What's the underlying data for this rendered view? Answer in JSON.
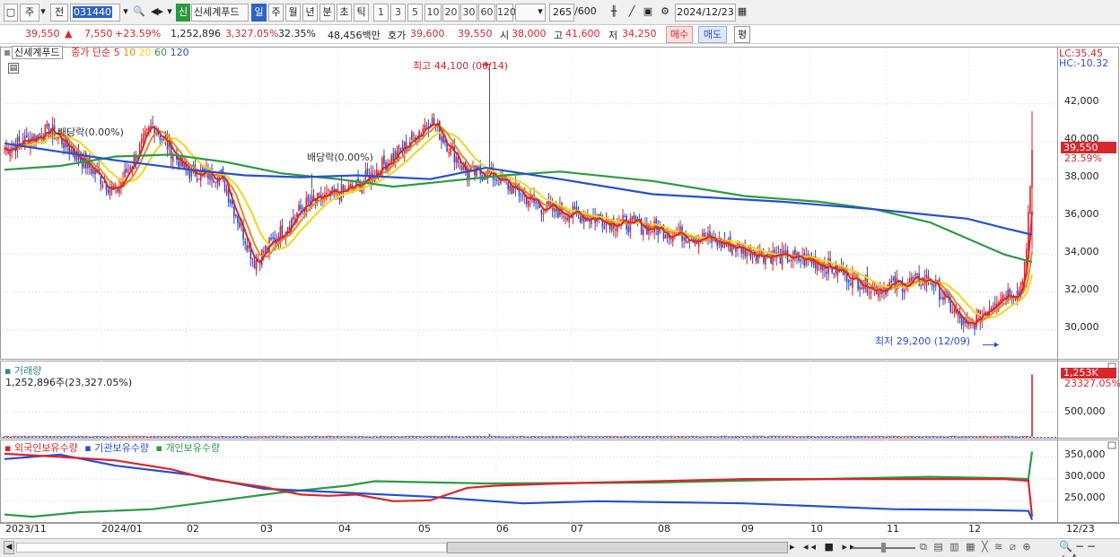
{
  "toolbar": {
    "type": "주",
    "prev": "전",
    "code": "031440",
    "stock_name": "신세계푸드",
    "badge": "신",
    "periods": [
      "일",
      "주",
      "월",
      "년",
      "분",
      "초",
      "틱"
    ],
    "active_period": "일",
    "intervals": [
      "1",
      "3",
      "5",
      "10",
      "20",
      "30",
      "60",
      "120"
    ],
    "count": "265",
    "count_total": "/600",
    "date": "2024/12/23"
  },
  "quote": {
    "price": "39,550",
    "arrow": "▲",
    "change": "7,550",
    "change_pct": "+23.59%",
    "volume": "1,252,896",
    "volume_pct": "3,327.05%",
    "turnover": "32.35%",
    "amount": "48,456백만",
    "bid_label": "호가",
    "bid": "39,600",
    "ask": "39,550",
    "open_label": "시",
    "open": "38,000",
    "high_label": "고",
    "high": "41,600",
    "low_label": "저",
    "low": "34,250",
    "buy_button": "매수",
    "sell_button": "매도",
    "eval_button": "평"
  },
  "legend": {
    "name": "신세계푸드",
    "ma_title": "종가 단순",
    "ma": [
      "5",
      "10",
      "20",
      "60",
      "120"
    ],
    "ma_colors": [
      "#d8262b",
      "#e8891a",
      "#f4d619",
      "#2e9a44",
      "#2450d2"
    ]
  },
  "lc": "LC:35.45",
  "hc": "HC:-10.32",
  "annotations": {
    "high": "최고 44,100 (06/14)",
    "low": "최저 29,200 (12/09)",
    "div1": "배당락(0.00%)",
    "div2": "배당락(0.00%)"
  },
  "price_tag": "39,550",
  "pct_tag": "23.59%",
  "price_axis": [
    "42,000",
    "40,000",
    "38,000",
    "36,000",
    "34,000",
    "32,000",
    "30,000"
  ],
  "volume": {
    "title": "거래량",
    "summary": "1,252,896주(23,327.05%)",
    "axis": "500,000",
    "tag": "1,253K",
    "pct_tag": "23327.05%"
  },
  "holdings": {
    "series": [
      "외국인보유수량",
      "기관보유수량",
      "개인보유수량"
    ],
    "axis": [
      "350,000",
      "300,000",
      "250,000"
    ]
  },
  "x_labels": [
    "2023/11",
    "2024/01",
    "02",
    "03",
    "04",
    "05",
    "06",
    "07",
    "08",
    "09",
    "10",
    "11",
    "12",
    "12/23"
  ],
  "chart_data": {
    "type": "candlestick",
    "y_range": [
      28600,
      44800
    ],
    "anchors_x": [
      0,
      25,
      60,
      80,
      98,
      117,
      135,
      162,
      190,
      215,
      230,
      250,
      262
    ],
    "anchors_close": [
      39600,
      40600,
      37300,
      40900,
      38400,
      38200,
      33600,
      36600,
      37600,
      39600,
      41200,
      38300,
      38300
    ],
    "anchors2_x": [
      262,
      290,
      320,
      350,
      380,
      410,
      440,
      470,
      500,
      520,
      537,
      543,
      548,
      552,
      555
    ],
    "anchors2_close": [
      38300,
      36500,
      35900,
      35400,
      34800,
      34000,
      33600,
      32200,
      32700,
      30000,
      31800,
      32000,
      32000,
      34000,
      39550
    ],
    "ma120": [
      [
        0,
        39900
      ],
      [
        60,
        39000
      ],
      [
        100,
        38500
      ],
      [
        130,
        38200
      ],
      [
        160,
        38100
      ],
      [
        190,
        38200
      ],
      [
        230,
        38000
      ],
      [
        260,
        38600
      ],
      [
        300,
        38000
      ],
      [
        350,
        37200
      ],
      [
        420,
        36800
      ],
      [
        470,
        36400
      ],
      [
        520,
        35900
      ],
      [
        540,
        35400
      ],
      [
        555,
        35050
      ]
    ],
    "ma60": [
      [
        0,
        38500
      ],
      [
        30,
        38700
      ],
      [
        60,
        39200
      ],
      [
        90,
        39300
      ],
      [
        120,
        38900
      ],
      [
        150,
        38300
      ],
      [
        180,
        38000
      ],
      [
        210,
        37600
      ],
      [
        240,
        37900
      ],
      [
        270,
        38200
      ],
      [
        300,
        38400
      ],
      [
        350,
        37900
      ],
      [
        400,
        37100
      ],
      [
        440,
        36800
      ],
      [
        470,
        36400
      ],
      [
        500,
        35700
      ],
      [
        540,
        34000
      ],
      [
        555,
        33600
      ]
    ],
    "volume_spike": 1252896,
    "volume_axis_max": 1300000,
    "holdings_range": [
      205000,
      375000
    ],
    "foreign": [
      [
        0,
        357000
      ],
      [
        30,
        350000
      ],
      [
        60,
        342000
      ],
      [
        90,
        322000
      ],
      [
        110,
        300000
      ],
      [
        140,
        282000
      ],
      [
        160,
        265000
      ],
      [
        175,
        262000
      ],
      [
        190,
        265000
      ],
      [
        210,
        250000
      ],
      [
        230,
        252000
      ],
      [
        250,
        280000
      ],
      [
        265,
        285000
      ],
      [
        300,
        290000
      ],
      [
        400,
        300000
      ],
      [
        500,
        300000
      ],
      [
        540,
        300000
      ],
      [
        553,
        296000
      ],
      [
        555,
        215000
      ]
    ],
    "institution": [
      [
        0,
        345000
      ],
      [
        30,
        355000
      ],
      [
        60,
        330000
      ],
      [
        100,
        310000
      ],
      [
        140,
        278000
      ],
      [
        180,
        270000
      ],
      [
        230,
        260000
      ],
      [
        280,
        245000
      ],
      [
        320,
        250000
      ],
      [
        400,
        245000
      ],
      [
        480,
        232000
      ],
      [
        530,
        230000
      ],
      [
        553,
        228000
      ],
      [
        555,
        208000
      ]
    ],
    "individual": [
      [
        0,
        220000
      ],
      [
        15,
        215000
      ],
      [
        40,
        225000
      ],
      [
        80,
        232000
      ],
      [
        110,
        248000
      ],
      [
        150,
        270000
      ],
      [
        185,
        285000
      ],
      [
        200,
        295000
      ],
      [
        260,
        290000
      ],
      [
        350,
        292000
      ],
      [
        440,
        300000
      ],
      [
        500,
        305000
      ],
      [
        540,
        302000
      ],
      [
        553,
        300000
      ],
      [
        555,
        362000
      ]
    ]
  }
}
